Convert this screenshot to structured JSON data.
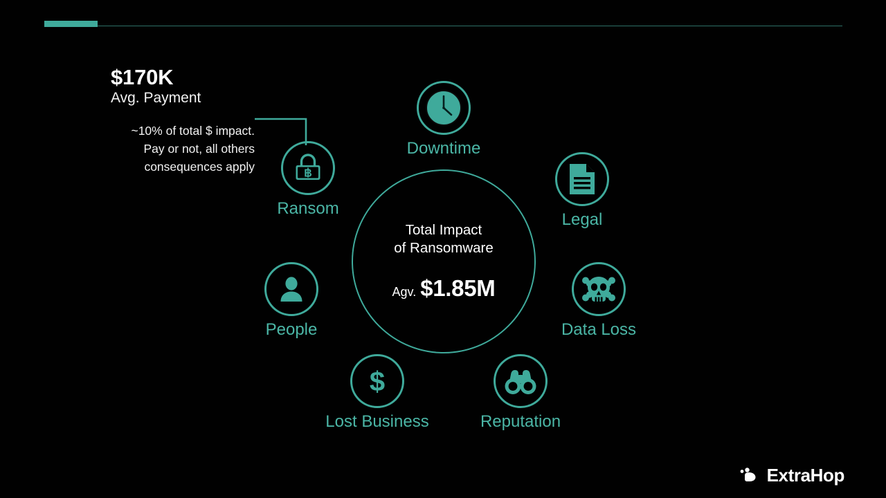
{
  "theme": {
    "background": "#010101",
    "accent_teal": "#3faa9b",
    "label_teal": "#4bb6a6",
    "text_white": "#ffffff"
  },
  "header": {
    "accent_bar": "accent-bar",
    "rule": "horizontal-rule"
  },
  "callout": {
    "amount": "$170K",
    "subtitle": "Avg. Payment",
    "note_line1": "~10% of total $ impact.",
    "note_line2": "Pay or not, all others",
    "note_line3": "consequences apply"
  },
  "hub": {
    "title_line1": "Total Impact",
    "title_line2": "of Ransomware",
    "value_prefix": "Agv.",
    "value": "$1.85M"
  },
  "nodes": [
    {
      "key": "downtime",
      "label": "Downtime",
      "icon": "clock-icon"
    },
    {
      "key": "legal",
      "label": "Legal",
      "icon": "document-icon"
    },
    {
      "key": "data_loss",
      "label": "Data Loss",
      "icon": "skull-crossbones-icon"
    },
    {
      "key": "reputation",
      "label": "Reputation",
      "icon": "binoculars-icon"
    },
    {
      "key": "lost_business",
      "label": "Lost Business",
      "icon": "dollar-icon"
    },
    {
      "key": "people",
      "label": "People",
      "icon": "person-icon"
    },
    {
      "key": "ransom",
      "label": "Ransom",
      "icon": "padlock-bitcoin-icon"
    }
  ],
  "logo": {
    "text": "ExtraHop",
    "mark": "extrahop-logo-mark"
  }
}
